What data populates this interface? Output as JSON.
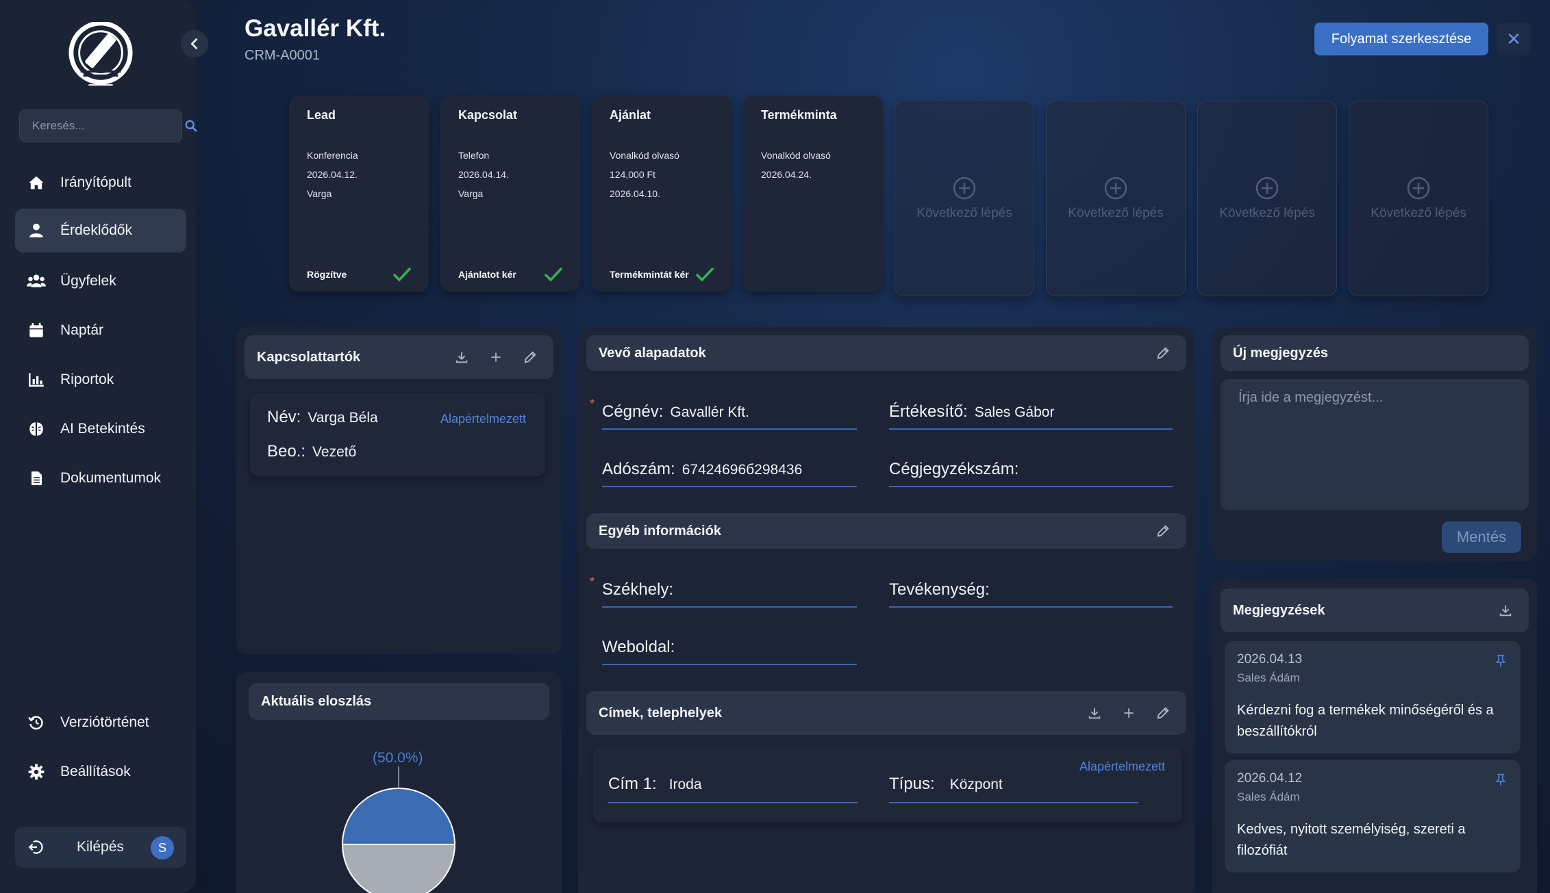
{
  "sidebar": {
    "search_placeholder": "Keresés...",
    "items": [
      {
        "label": "Irányítópult",
        "icon": "home-icon"
      },
      {
        "label": "Érdeklődők",
        "icon": "user-icon",
        "active": true
      },
      {
        "label": "Ügyfelek",
        "icon": "users-icon"
      },
      {
        "label": "Naptár",
        "icon": "calendar-icon"
      },
      {
        "label": "Riportok",
        "icon": "bar-chart-icon"
      },
      {
        "label": "AI Betekintés",
        "icon": "brain-icon"
      },
      {
        "label": "Dokumentumok",
        "icon": "document-icon"
      }
    ],
    "bottom_items": [
      {
        "label": "Verziótörténet",
        "icon": "history-icon"
      },
      {
        "label": "Beállítások",
        "icon": "gear-icon"
      }
    ],
    "logout_label": "Kilépés",
    "avatar_initial": "S"
  },
  "header": {
    "title": "Gavallér Kft.",
    "subtitle": "CRM-A0001",
    "edit_process_label": "Folyamat szerkesztése",
    "close_label": "✕"
  },
  "stages": [
    {
      "title": "Lead",
      "lines": [
        "Konferencia",
        "2026.04.12.",
        "Varga"
      ],
      "status": "Rögzítve",
      "done": true
    },
    {
      "title": "Kapcsolat",
      "lines": [
        "Telefon",
        "2026.04.14.",
        "Varga"
      ],
      "status": "Ajánlatot kér",
      "done": true
    },
    {
      "title": "Ajánlat",
      "lines": [
        "Vonalkód olvasó",
        "124,000 Ft",
        "2026.04.10."
      ],
      "status": "Termékmintát kér",
      "done": true
    },
    {
      "title": "Termékminta",
      "lines": [
        "Vonalkód olvasó",
        "2026.04.24."
      ],
      "status": "",
      "done": false
    }
  ],
  "next_step_label": "Következő lépés",
  "contacts": {
    "title": "Kapcsolattartók",
    "name_label": "Név:",
    "name_value": "Varga Béla",
    "role_label": "Beo.:",
    "role_value": "Vezető",
    "default_label": "Alapértelmezett"
  },
  "distribution": {
    "title": "Aktuális eloszlás",
    "percent_label": "(50.0%)"
  },
  "chart_data": {
    "type": "pie",
    "values": [
      50,
      50
    ],
    "labels": [
      "(50.0%)"
    ],
    "colors": [
      "#3b6bb3",
      "#a8acb4"
    ]
  },
  "basic": {
    "title": "Vevő alapadatok",
    "company_label": "Cégnév:",
    "company_value": "Gavallér Kft.",
    "sales_label": "Értékesítő:",
    "sales_value": "Sales Gábor",
    "tax_label": "Adószám:",
    "tax_value": "67424696б298436",
    "reg_label": "Cégjegyzékszám:",
    "reg_value": ""
  },
  "other": {
    "title": "Egyéb információk",
    "hq_label": "Székhely:",
    "activity_label": "Tevékenység:",
    "web_label": "Weboldal:"
  },
  "addresses": {
    "title": "Címek, telephelyek",
    "default_label": "Alapértelmezett",
    "addr_label": "Cím 1:",
    "addr_value": "Iroda",
    "type_label": "Típus:",
    "type_value": "Központ"
  },
  "new_note": {
    "title": "Új megjegyzés",
    "placeholder": "Írja ide a megjegyzést...",
    "save_label": "Mentés"
  },
  "notes": {
    "title": "Megjegyzések",
    "items": [
      {
        "date": "2026.04.13",
        "author": "Sales Ádám",
        "text": "Kérdezni fog a termékek minőségéről és a beszállítókról"
      },
      {
        "date": "2026.04.12",
        "author": "Sales Ádám",
        "text": "Kedves, nyitott személyiség, szereti a filozófiát"
      }
    ]
  },
  "colors": {
    "accent": "#3a6fc4",
    "success": "#38b24f",
    "link": "#4f86dd",
    "required": "#e06c4a"
  }
}
